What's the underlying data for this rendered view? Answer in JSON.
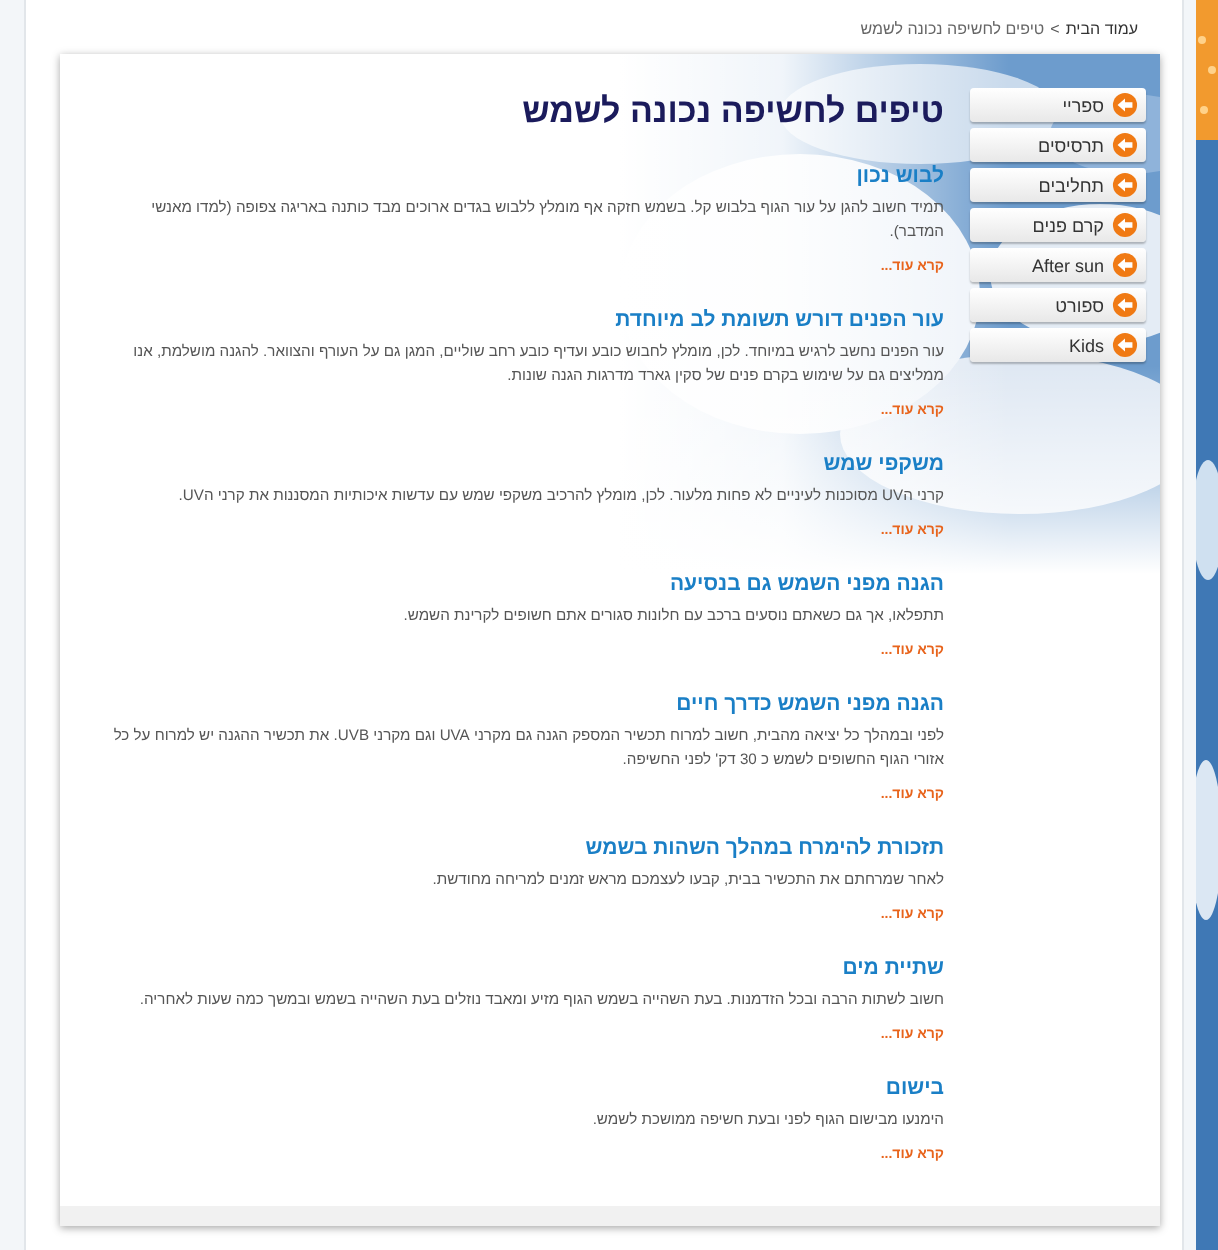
{
  "breadcrumb": {
    "separator": ">",
    "items": [
      {
        "label": "עמוד הבית",
        "kind": "link"
      },
      {
        "label": "טיפים לחשיפה נכונה לשמש",
        "kind": "current"
      }
    ]
  },
  "page_title": "טיפים לחשיפה נכונה לשמש",
  "articles": [
    {
      "title": "לבוש נכון",
      "body": "תמיד חשוב להגן על עור הגוף בלבוש קל. בשמש חזקה אף מומלץ ללבוש בגדים ארוכים מבד כותנה באריגה צפופה (למדו מאנשי המדבר).",
      "read_more": "קרא עוד..."
    },
    {
      "title": "עור הפנים דורש תשומת לב מיוחדת",
      "body": "עור הפנים נחשב לרגיש במיוחד. לכן, מומלץ לחבוש כובע ועדיף כובע רחב שוליים, המגן גם על העורף והצוואר. להגנה מושלמת, אנו ממליצים גם על שימוש בקרם פנים של סקין גארד מדרגות הגנה שונות.",
      "read_more": "קרא עוד..."
    },
    {
      "title": "משקפי שמש",
      "body": "קרני הUV מסוכנות לעיניים לא פחות מלעור. לכן, מומלץ להרכיב משקפי שמש עם עדשות איכותיות המסננות את קרני הUV.",
      "read_more": "קרא עוד..."
    },
    {
      "title": "הגנה מפני השמש גם בנסיעה",
      "body": "תתפלאו, אך גם כשאתם נוסעים ברכב עם חלונות סגורים אתם חשופים לקרינת השמש.",
      "read_more": "קרא עוד..."
    },
    {
      "title": "הגנה מפני השמש כדרך חיים",
      "body": "לפני ובמהלך כל יציאה מהבית, חשוב למרוח תכשיר המספק הגנה גם מקרני UVA וגם מקרני UVB. את תכשיר ההגנה יש למרוח על כל אזורי הגוף החשופים לשמש כ 30 דק' לפני החשיפה.",
      "read_more": "קרא עוד..."
    },
    {
      "title": "תזכורת להימרח במהלך השהות בשמש",
      "body": "לאחר שמרחתם את התכשיר בבית, קבעו לעצמכם מראש זמנים למריחה מחודשת.",
      "read_more": "קרא עוד..."
    },
    {
      "title": "שתיית מים",
      "body": "חשוב לשתות הרבה ובכל הזדמנות. בעת השהייה בשמש הגוף מזיע ומאבד נוזלים בעת השהייה בשמש ובמשך כמה שעות לאחריה.",
      "read_more": "קרא עוד..."
    },
    {
      "title": "בישום",
      "body": "הימנעו מבישום הגוף לפני ובעת חשיפה ממושכת לשמש.",
      "read_more": "קרא עוד..."
    }
  ],
  "sidebar": {
    "items": [
      {
        "label": "ספריי"
      },
      {
        "label": "תרסיסים"
      },
      {
        "label": "תחליבים"
      },
      {
        "label": "קרם פנים"
      },
      {
        "label": "After sun"
      },
      {
        "label": "ספורט"
      },
      {
        "label": "Kids"
      }
    ]
  }
}
